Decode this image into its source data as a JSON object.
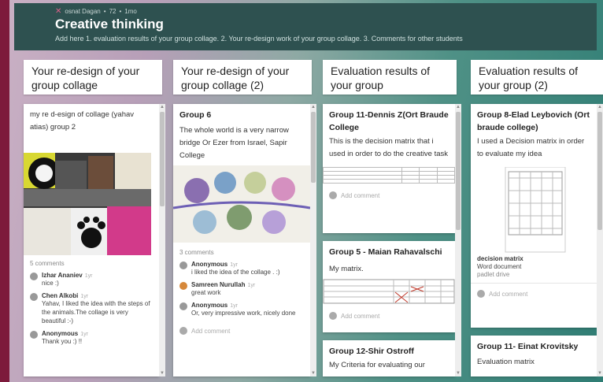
{
  "header": {
    "author": "osnat Dagan",
    "karma": "72",
    "time": "1mo",
    "title": "Creative thinking",
    "description": "Add here 1. evaluation results of your group collage. 2. Your re-design work of your group collage. 3. Comments for other students"
  },
  "columns": [
    {
      "title": "Your re-design of your group collage"
    },
    {
      "title": "Your re-design of your group collage (2)"
    },
    {
      "title": "Evaluation results of your group"
    },
    {
      "title": "Evaluation results of your group (2)"
    }
  ],
  "col1": {
    "card1_text": "my re d-esign of  collage (yahav atias) group 2",
    "comments_count": "5 comments",
    "comments": [
      {
        "author": "Izhar Ananiev",
        "time": "1yr",
        "text": "nice :)"
      },
      {
        "author": "Chen Alkobi",
        "time": "1yr",
        "text": "Yahav, I liked the idea with the steps of the animals.The collage is very beautiful :-)"
      },
      {
        "author": "Anonymous",
        "time": "1yr",
        "text": "Thank you :) !!"
      }
    ]
  },
  "col2": {
    "card_title": "Group 6",
    "card_text": "The whole world is a very narrow bridge Or Ezer from Israel, Sapir College",
    "comments_count": "3 comments",
    "comments": [
      {
        "author": "Anonymous",
        "time": "1yr",
        "text": "i liked the idea of the collage . :)"
      },
      {
        "author": "Samreen Nurullah",
        "time": "1yr",
        "text": "great work"
      },
      {
        "author": "Anonymous",
        "time": "1yr",
        "text": "Or, very impressive work, nicely done"
      }
    ],
    "add_comment": "Add comment"
  },
  "col3": {
    "card1_title": "Group 11-Dennis Z(Ort Braude College",
    "card1_text": "This is the decision matrix that i used in order to do the creative task",
    "add_comment": "Add comment",
    "card2_title": "Group 5 - Maian Rahavalschi",
    "card2_text": "My matrix.",
    "add_comment2": "Add comment",
    "card3_title": "Group 12-Shir Ostroff",
    "card3_text": "My Criteria for evaluating our"
  },
  "col4": {
    "card1_title": "Group 8-Elad Leybovich (Ort braude college)",
    "card1_text": "I used a Decision matrix in order to evaluate my idea",
    "attachment_title": "decision matrix",
    "attachment_type": "Word document",
    "attachment_source": "padlet drive",
    "add_comment": "Add comment",
    "card2_title": "Group 11- Einat Krovitsky",
    "card2_text": "Evaluation matrix"
  },
  "colors": {
    "header": "#2e5150",
    "accent": "#7d1a3b"
  }
}
